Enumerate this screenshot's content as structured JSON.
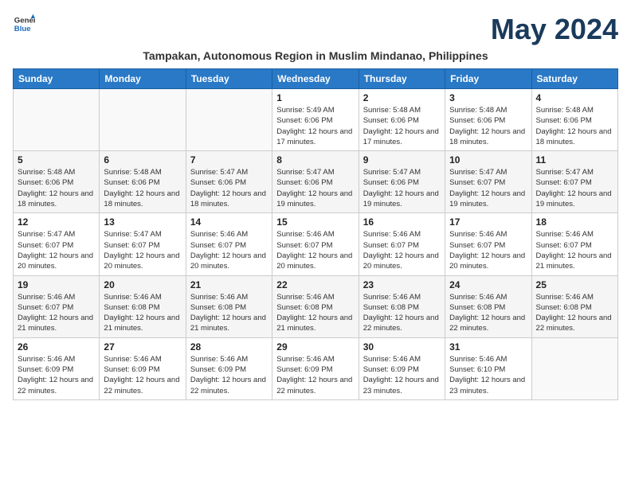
{
  "logo": {
    "line1": "General",
    "line2": "Blue"
  },
  "title": "May 2024",
  "subtitle": "Tampakan, Autonomous Region in Muslim Mindanao, Philippines",
  "headers": [
    "Sunday",
    "Monday",
    "Tuesday",
    "Wednesday",
    "Thursday",
    "Friday",
    "Saturday"
  ],
  "weeks": [
    [
      {
        "day": "",
        "info": ""
      },
      {
        "day": "",
        "info": ""
      },
      {
        "day": "",
        "info": ""
      },
      {
        "day": "1",
        "info": "Sunrise: 5:49 AM\nSunset: 6:06 PM\nDaylight: 12 hours and 17 minutes."
      },
      {
        "day": "2",
        "info": "Sunrise: 5:48 AM\nSunset: 6:06 PM\nDaylight: 12 hours and 17 minutes."
      },
      {
        "day": "3",
        "info": "Sunrise: 5:48 AM\nSunset: 6:06 PM\nDaylight: 12 hours and 18 minutes."
      },
      {
        "day": "4",
        "info": "Sunrise: 5:48 AM\nSunset: 6:06 PM\nDaylight: 12 hours and 18 minutes."
      }
    ],
    [
      {
        "day": "5",
        "info": "Sunrise: 5:48 AM\nSunset: 6:06 PM\nDaylight: 12 hours and 18 minutes."
      },
      {
        "day": "6",
        "info": "Sunrise: 5:48 AM\nSunset: 6:06 PM\nDaylight: 12 hours and 18 minutes."
      },
      {
        "day": "7",
        "info": "Sunrise: 5:47 AM\nSunset: 6:06 PM\nDaylight: 12 hours and 18 minutes."
      },
      {
        "day": "8",
        "info": "Sunrise: 5:47 AM\nSunset: 6:06 PM\nDaylight: 12 hours and 19 minutes."
      },
      {
        "day": "9",
        "info": "Sunrise: 5:47 AM\nSunset: 6:06 PM\nDaylight: 12 hours and 19 minutes."
      },
      {
        "day": "10",
        "info": "Sunrise: 5:47 AM\nSunset: 6:07 PM\nDaylight: 12 hours and 19 minutes."
      },
      {
        "day": "11",
        "info": "Sunrise: 5:47 AM\nSunset: 6:07 PM\nDaylight: 12 hours and 19 minutes."
      }
    ],
    [
      {
        "day": "12",
        "info": "Sunrise: 5:47 AM\nSunset: 6:07 PM\nDaylight: 12 hours and 20 minutes."
      },
      {
        "day": "13",
        "info": "Sunrise: 5:47 AM\nSunset: 6:07 PM\nDaylight: 12 hours and 20 minutes."
      },
      {
        "day": "14",
        "info": "Sunrise: 5:46 AM\nSunset: 6:07 PM\nDaylight: 12 hours and 20 minutes."
      },
      {
        "day": "15",
        "info": "Sunrise: 5:46 AM\nSunset: 6:07 PM\nDaylight: 12 hours and 20 minutes."
      },
      {
        "day": "16",
        "info": "Sunrise: 5:46 AM\nSunset: 6:07 PM\nDaylight: 12 hours and 20 minutes."
      },
      {
        "day": "17",
        "info": "Sunrise: 5:46 AM\nSunset: 6:07 PM\nDaylight: 12 hours and 20 minutes."
      },
      {
        "day": "18",
        "info": "Sunrise: 5:46 AM\nSunset: 6:07 PM\nDaylight: 12 hours and 21 minutes."
      }
    ],
    [
      {
        "day": "19",
        "info": "Sunrise: 5:46 AM\nSunset: 6:07 PM\nDaylight: 12 hours and 21 minutes."
      },
      {
        "day": "20",
        "info": "Sunrise: 5:46 AM\nSunset: 6:08 PM\nDaylight: 12 hours and 21 minutes."
      },
      {
        "day": "21",
        "info": "Sunrise: 5:46 AM\nSunset: 6:08 PM\nDaylight: 12 hours and 21 minutes."
      },
      {
        "day": "22",
        "info": "Sunrise: 5:46 AM\nSunset: 6:08 PM\nDaylight: 12 hours and 21 minutes."
      },
      {
        "day": "23",
        "info": "Sunrise: 5:46 AM\nSunset: 6:08 PM\nDaylight: 12 hours and 22 minutes."
      },
      {
        "day": "24",
        "info": "Sunrise: 5:46 AM\nSunset: 6:08 PM\nDaylight: 12 hours and 22 minutes."
      },
      {
        "day": "25",
        "info": "Sunrise: 5:46 AM\nSunset: 6:08 PM\nDaylight: 12 hours and 22 minutes."
      }
    ],
    [
      {
        "day": "26",
        "info": "Sunrise: 5:46 AM\nSunset: 6:09 PM\nDaylight: 12 hours and 22 minutes."
      },
      {
        "day": "27",
        "info": "Sunrise: 5:46 AM\nSunset: 6:09 PM\nDaylight: 12 hours and 22 minutes."
      },
      {
        "day": "28",
        "info": "Sunrise: 5:46 AM\nSunset: 6:09 PM\nDaylight: 12 hours and 22 minutes."
      },
      {
        "day": "29",
        "info": "Sunrise: 5:46 AM\nSunset: 6:09 PM\nDaylight: 12 hours and 22 minutes."
      },
      {
        "day": "30",
        "info": "Sunrise: 5:46 AM\nSunset: 6:09 PM\nDaylight: 12 hours and 23 minutes."
      },
      {
        "day": "31",
        "info": "Sunrise: 5:46 AM\nSunset: 6:10 PM\nDaylight: 12 hours and 23 minutes."
      },
      {
        "day": "",
        "info": ""
      }
    ]
  ]
}
